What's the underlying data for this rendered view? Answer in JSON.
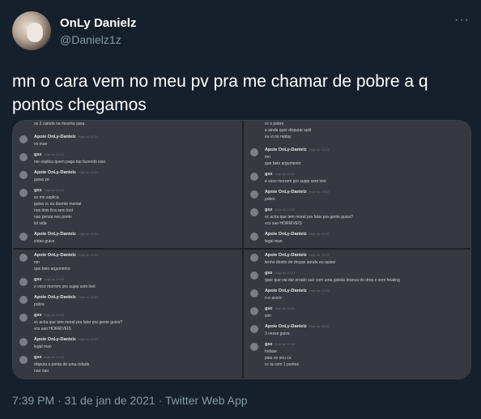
{
  "tweet": {
    "name": "OnLy Danielz",
    "handle": "@Danielz1z",
    "more": "···",
    "text": "mn o cara vem no meu pv pra me chamar de pobre a q pontos chegamos",
    "meta": "7:39 PM · 31 de jan de 2021 · Twitter Web App"
  },
  "screens": {
    "p1": {
      "top_line": "os 2 caindo na mesma casa",
      "msgs": [
        {
          "author": "Apoie OnLy-Danielz",
          "time": "Hoje às 19:31",
          "lines": [
            "vo man"
          ]
        },
        {
          "author": "gsx",
          "time": "Hoje às 19:31",
          "lines": [
            "me explica quem paga top fazendo isso"
          ]
        },
        {
          "author": "Apoie OnLy-Danielz",
          "time": "Hoje às 19:31",
          "lines": [
            "guiva ze"
          ]
        },
        {
          "author": "gsx",
          "time": "Hoje às 19:31",
          "lines": [
            "so me explica",
            "guiva vc eu doente mental",
            "nos dois fica sem loot",
            "nao pensa nos ponto",
            "lol vida"
          ]
        },
        {
          "author": "Apoie OnLy-Danielz",
          "time": "Hoje às 19:31",
          "lines": [
            "virtas guiva"
          ]
        },
        {
          "author": "gsx",
          "time": "Hoje às 19:31",
          "lines": [
            "mina bosica"
          ]
        }
      ]
    },
    "p2": {
      "top_lines": [
        "vc e pobre",
        "e ainda quer disputar split",
        "eu vi no replay"
      ],
      "msgs": [
        {
          "author": "Apoie OnLy-Danielz",
          "time": "Hoje às 19:31",
          "lines": [
            "mn",
            "que belo argumento"
          ]
        },
        {
          "author": "gsx",
          "time": "Hoje às 19:32",
          "lines": [
            "e voce morrem pro sujep sem loot"
          ]
        },
        {
          "author": "Apoie OnLy-Danielz",
          "time": "Hoje às 19:32",
          "lines": [
            "pobre"
          ]
        },
        {
          "author": "gsx",
          "time": "Hoje às 19:32",
          "lines": [
            "vc acha que tem moral pra falar pra gente guiva?",
            "vcs sao HORRIVEIS"
          ]
        },
        {
          "author": "Apoie OnLy-Danielz",
          "time": "Hoje às 19:32",
          "lines": [
            "legal man"
          ]
        }
      ]
    },
    "p3": {
      "msgs": [
        {
          "author": "Apoie OnLy-Danielz",
          "time": "Hoje às 19:31",
          "lines": [
            "mn",
            "que belo argumento"
          ]
        },
        {
          "author": "gsx",
          "time": "Hoje às 19:32",
          "lines": [
            "e voce morrem pro sujep sem loot"
          ]
        },
        {
          "author": "Apoie OnLy-Danielz",
          "time": "Hoje às 19:32",
          "lines": [
            "pobre"
          ]
        },
        {
          "author": "gsx",
          "time": "Hoje às 19:32",
          "lines": [
            "vc acha que tem moral pra falar pra gente guiva?",
            "vcs sao HORRIVEIS"
          ]
        },
        {
          "author": "Apoie OnLy-Danielz",
          "time": "Hoje às 19:32",
          "lines": [
            "legal man"
          ]
        },
        {
          "author": "gsx",
          "time": "Hoje às 19:32",
          "lines": [
            "disputa a ponta de uma cidade",
            "nao nao"
          ]
        },
        {
          "author": "Apoie OnLy-Danielz",
          "time": "Hoje às 19:33",
          "lines": [
            "vc eu posso"
          ]
        }
      ]
    },
    "p4": {
      "msgs": [
        {
          "author": "Apoie OnLy-Danielz",
          "time": "Hoje às 19:33",
          "lines": [
            "tenho direito de dropar aonde eu quiser"
          ]
        },
        {
          "author": "gsx",
          "time": "Hoje às 19:33",
          "lines": [
            "quer que vai dar errado sair com uma pistola branca do drop e sem healing"
          ]
        },
        {
          "author": "Apoie OnLy-Danielz",
          "time": "Hoje às 19:33",
          "lines": [
            "n e acere"
          ]
        },
        {
          "author": "gsx",
          "time": "Hoje às 19:33",
          "lines": [
            "sim"
          ]
        },
        {
          "author": "Apoie OnLy-Danielz",
          "time": "Hoje às 19:33",
          "lines": [
            "3 vezes guiva"
          ]
        },
        {
          "author": "gsx",
          "time": "Hoje às 19:33",
          "lines": [
            "fodase",
            "paiu no seu cu",
            "vc ta com 1 pontos"
          ]
        }
      ]
    }
  }
}
